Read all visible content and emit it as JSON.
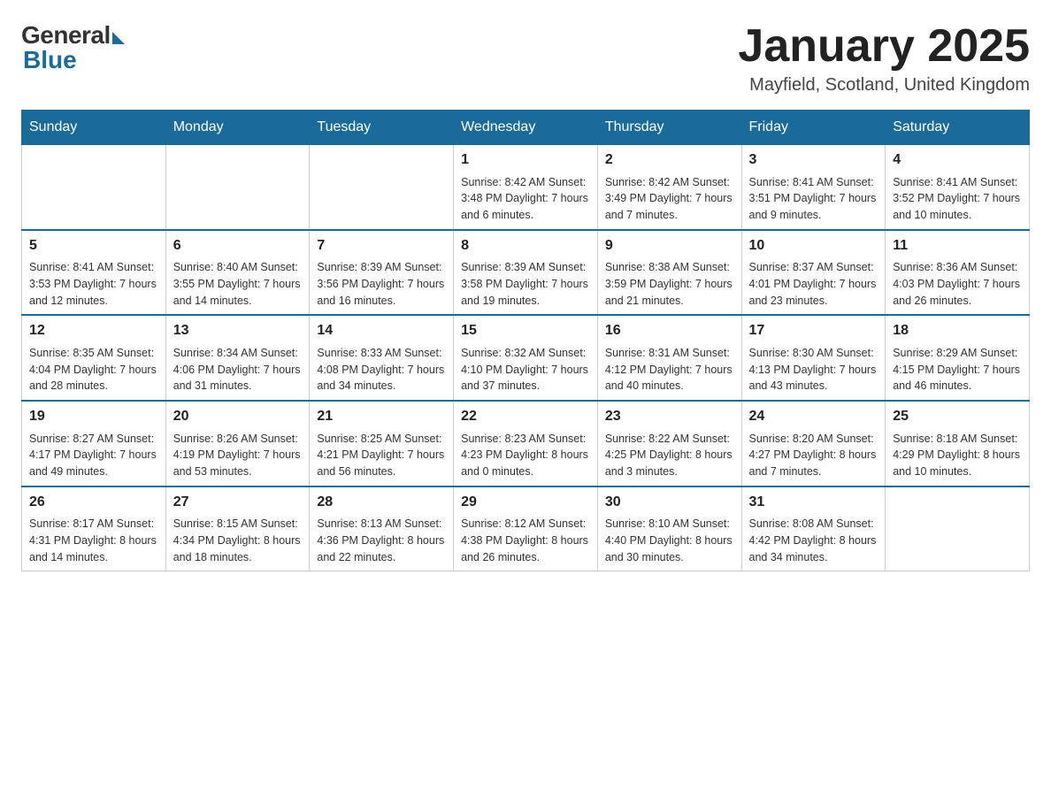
{
  "header": {
    "logo_general": "General",
    "logo_blue": "Blue",
    "month_title": "January 2025",
    "location": "Mayfield, Scotland, United Kingdom"
  },
  "days_of_week": [
    "Sunday",
    "Monday",
    "Tuesday",
    "Wednesday",
    "Thursday",
    "Friday",
    "Saturday"
  ],
  "weeks": [
    [
      {
        "day": "",
        "info": ""
      },
      {
        "day": "",
        "info": ""
      },
      {
        "day": "",
        "info": ""
      },
      {
        "day": "1",
        "info": "Sunrise: 8:42 AM\nSunset: 3:48 PM\nDaylight: 7 hours\nand 6 minutes."
      },
      {
        "day": "2",
        "info": "Sunrise: 8:42 AM\nSunset: 3:49 PM\nDaylight: 7 hours\nand 7 minutes."
      },
      {
        "day": "3",
        "info": "Sunrise: 8:41 AM\nSunset: 3:51 PM\nDaylight: 7 hours\nand 9 minutes."
      },
      {
        "day": "4",
        "info": "Sunrise: 8:41 AM\nSunset: 3:52 PM\nDaylight: 7 hours\nand 10 minutes."
      }
    ],
    [
      {
        "day": "5",
        "info": "Sunrise: 8:41 AM\nSunset: 3:53 PM\nDaylight: 7 hours\nand 12 minutes."
      },
      {
        "day": "6",
        "info": "Sunrise: 8:40 AM\nSunset: 3:55 PM\nDaylight: 7 hours\nand 14 minutes."
      },
      {
        "day": "7",
        "info": "Sunrise: 8:39 AM\nSunset: 3:56 PM\nDaylight: 7 hours\nand 16 minutes."
      },
      {
        "day": "8",
        "info": "Sunrise: 8:39 AM\nSunset: 3:58 PM\nDaylight: 7 hours\nand 19 minutes."
      },
      {
        "day": "9",
        "info": "Sunrise: 8:38 AM\nSunset: 3:59 PM\nDaylight: 7 hours\nand 21 minutes."
      },
      {
        "day": "10",
        "info": "Sunrise: 8:37 AM\nSunset: 4:01 PM\nDaylight: 7 hours\nand 23 minutes."
      },
      {
        "day": "11",
        "info": "Sunrise: 8:36 AM\nSunset: 4:03 PM\nDaylight: 7 hours\nand 26 minutes."
      }
    ],
    [
      {
        "day": "12",
        "info": "Sunrise: 8:35 AM\nSunset: 4:04 PM\nDaylight: 7 hours\nand 28 minutes."
      },
      {
        "day": "13",
        "info": "Sunrise: 8:34 AM\nSunset: 4:06 PM\nDaylight: 7 hours\nand 31 minutes."
      },
      {
        "day": "14",
        "info": "Sunrise: 8:33 AM\nSunset: 4:08 PM\nDaylight: 7 hours\nand 34 minutes."
      },
      {
        "day": "15",
        "info": "Sunrise: 8:32 AM\nSunset: 4:10 PM\nDaylight: 7 hours\nand 37 minutes."
      },
      {
        "day": "16",
        "info": "Sunrise: 8:31 AM\nSunset: 4:12 PM\nDaylight: 7 hours\nand 40 minutes."
      },
      {
        "day": "17",
        "info": "Sunrise: 8:30 AM\nSunset: 4:13 PM\nDaylight: 7 hours\nand 43 minutes."
      },
      {
        "day": "18",
        "info": "Sunrise: 8:29 AM\nSunset: 4:15 PM\nDaylight: 7 hours\nand 46 minutes."
      }
    ],
    [
      {
        "day": "19",
        "info": "Sunrise: 8:27 AM\nSunset: 4:17 PM\nDaylight: 7 hours\nand 49 minutes."
      },
      {
        "day": "20",
        "info": "Sunrise: 8:26 AM\nSunset: 4:19 PM\nDaylight: 7 hours\nand 53 minutes."
      },
      {
        "day": "21",
        "info": "Sunrise: 8:25 AM\nSunset: 4:21 PM\nDaylight: 7 hours\nand 56 minutes."
      },
      {
        "day": "22",
        "info": "Sunrise: 8:23 AM\nSunset: 4:23 PM\nDaylight: 8 hours\nand 0 minutes."
      },
      {
        "day": "23",
        "info": "Sunrise: 8:22 AM\nSunset: 4:25 PM\nDaylight: 8 hours\nand 3 minutes."
      },
      {
        "day": "24",
        "info": "Sunrise: 8:20 AM\nSunset: 4:27 PM\nDaylight: 8 hours\nand 7 minutes."
      },
      {
        "day": "25",
        "info": "Sunrise: 8:18 AM\nSunset: 4:29 PM\nDaylight: 8 hours\nand 10 minutes."
      }
    ],
    [
      {
        "day": "26",
        "info": "Sunrise: 8:17 AM\nSunset: 4:31 PM\nDaylight: 8 hours\nand 14 minutes."
      },
      {
        "day": "27",
        "info": "Sunrise: 8:15 AM\nSunset: 4:34 PM\nDaylight: 8 hours\nand 18 minutes."
      },
      {
        "day": "28",
        "info": "Sunrise: 8:13 AM\nSunset: 4:36 PM\nDaylight: 8 hours\nand 22 minutes."
      },
      {
        "day": "29",
        "info": "Sunrise: 8:12 AM\nSunset: 4:38 PM\nDaylight: 8 hours\nand 26 minutes."
      },
      {
        "day": "30",
        "info": "Sunrise: 8:10 AM\nSunset: 4:40 PM\nDaylight: 8 hours\nand 30 minutes."
      },
      {
        "day": "31",
        "info": "Sunrise: 8:08 AM\nSunset: 4:42 PM\nDaylight: 8 hours\nand 34 minutes."
      },
      {
        "day": "",
        "info": ""
      }
    ]
  ]
}
